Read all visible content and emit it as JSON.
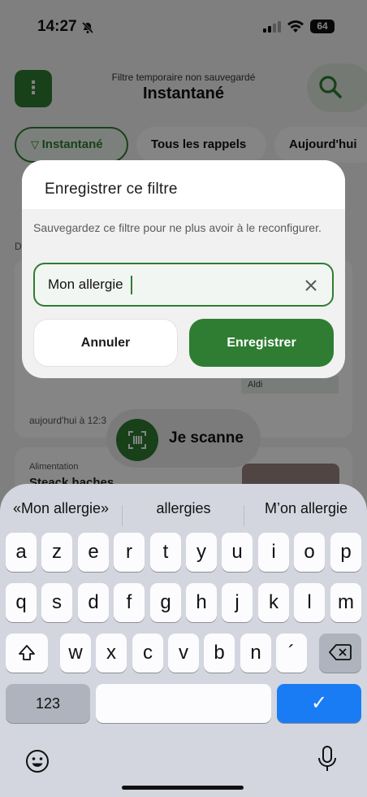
{
  "status_bar": {
    "time": "14:27",
    "battery": "64"
  },
  "header": {
    "subtitle": "Filtre temporaire non sauvegardé",
    "title": "Instantané"
  },
  "chips": [
    "Instantané",
    "Tous les rappels",
    "Aujourd'hui"
  ],
  "background": {
    "section_letter": "D",
    "card_tag": "Aldi",
    "card_date": "aujourd'hui à 12:3",
    "category": "Alimentation",
    "product": "Steack haches"
  },
  "scan_button": {
    "label": "Je scanne"
  },
  "dialog": {
    "title": "Enregistrer ce filtre",
    "description": "Sauvegardez ce filtre pour ne plus avoir à le reconfigurer.",
    "input_value": "Mon allergie",
    "cancel_label": "Annuler",
    "save_label": "Enregistrer"
  },
  "keyboard": {
    "suggestions": [
      "«Mon allergie»",
      "allergies",
      "M’on allergie"
    ],
    "row1": [
      "a",
      "z",
      "e",
      "r",
      "t",
      "y",
      "u",
      "i",
      "o",
      "p"
    ],
    "row2": [
      "q",
      "s",
      "d",
      "f",
      "g",
      "h",
      "j",
      "k",
      "l",
      "m"
    ],
    "row3": [
      "w",
      "x",
      "c",
      "v",
      "b",
      "n",
      "´"
    ],
    "numbers_label": "123",
    "return_label": "✓"
  },
  "colors": {
    "accent": "#2f7d32",
    "keyboard_bg": "#d3d6de",
    "return_key": "#1a7cf5"
  }
}
